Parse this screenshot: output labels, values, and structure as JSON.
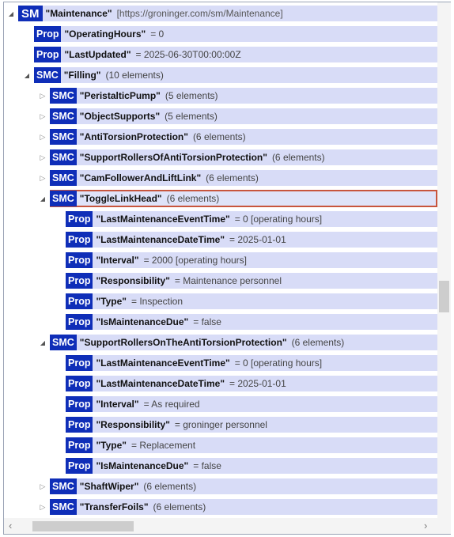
{
  "tree": {
    "root": {
      "badge": "SM",
      "name": "\"Maintenance\"",
      "info": "[https://groninger.com/sm/Maintenance]"
    },
    "operating_hours": {
      "badge": "Prop",
      "name": "\"OperatingHours\"",
      "info": "= 0"
    },
    "last_updated": {
      "badge": "Prop",
      "name": "\"LastUpdated\"",
      "info": "= 2025-06-30T00:00:00Z"
    },
    "filling": {
      "badge": "SMC",
      "name": "\"Filling\"",
      "info": "(10 elements)"
    },
    "peristaltic_pump": {
      "badge": "SMC",
      "name": "\"PeristalticPump\"",
      "info": "(5 elements)"
    },
    "object_supports": {
      "badge": "SMC",
      "name": "\"ObjectSupports\"",
      "info": "(5 elements)"
    },
    "anti_torsion": {
      "badge": "SMC",
      "name": "\"AntiTorsionProtection\"",
      "info": "(6 elements)"
    },
    "support_rollers_of": {
      "badge": "SMC",
      "name": "\"SupportRollersOfAntiTorsionProtection\"",
      "info": "(6 elements)"
    },
    "cam_follower": {
      "badge": "SMC",
      "name": "\"CamFollowerAndLiftLink\"",
      "info": "(6 elements)"
    },
    "toggle_link_head": {
      "badge": "SMC",
      "name": "\"ToggleLinkHead\"",
      "info": "(6 elements)",
      "props": [
        {
          "badge": "Prop",
          "name": "\"LastMaintenanceEventTime\"",
          "info": "= 0 [operating hours]"
        },
        {
          "badge": "Prop",
          "name": "\"LastMaintenanceDateTime\"",
          "info": "= 2025-01-01"
        },
        {
          "badge": "Prop",
          "name": "\"Interval\"",
          "info": "= 2000 [operating hours]"
        },
        {
          "badge": "Prop",
          "name": "\"Responsibility\"",
          "info": "= Maintenance personnel"
        },
        {
          "badge": "Prop",
          "name": "\"Type\"",
          "info": "= Inspection"
        },
        {
          "badge": "Prop",
          "name": "\"IsMaintenanceDue\"",
          "info": "= false"
        }
      ]
    },
    "support_rollers_on": {
      "badge": "SMC",
      "name": "\"SupportRollersOnTheAntiTorsionProtection\"",
      "info": "(6 elements)",
      "props": [
        {
          "badge": "Prop",
          "name": "\"LastMaintenanceEventTime\"",
          "info": "= 0 [operating hours]"
        },
        {
          "badge": "Prop",
          "name": "\"LastMaintenanceDateTime\"",
          "info": "= 2025-01-01"
        },
        {
          "badge": "Prop",
          "name": "\"Interval\"",
          "info": "= As required"
        },
        {
          "badge": "Prop",
          "name": "\"Responsibility\"",
          "info": "= groninger personnel"
        },
        {
          "badge": "Prop",
          "name": "\"Type\"",
          "info": "= Replacement"
        },
        {
          "badge": "Prop",
          "name": "\"IsMaintenanceDue\"",
          "info": "= false"
        }
      ]
    },
    "shaft_wiper": {
      "badge": "SMC",
      "name": "\"ShaftWiper\"",
      "info": "(6 elements)"
    },
    "transfer_foils": {
      "badge": "SMC",
      "name": "\"TransferFoils\"",
      "info": "(6 elements)"
    }
  },
  "icons": {
    "expanded": "expanded-triangle-icon",
    "collapsed": "collapsed-triangle-icon",
    "scroll_left": "chevron-left-icon",
    "scroll_right": "chevron-right-icon"
  },
  "colors": {
    "badge_bg": "#0f2eb8",
    "row_bg": "#d8dcf7",
    "selected_border": "#c8553d"
  }
}
